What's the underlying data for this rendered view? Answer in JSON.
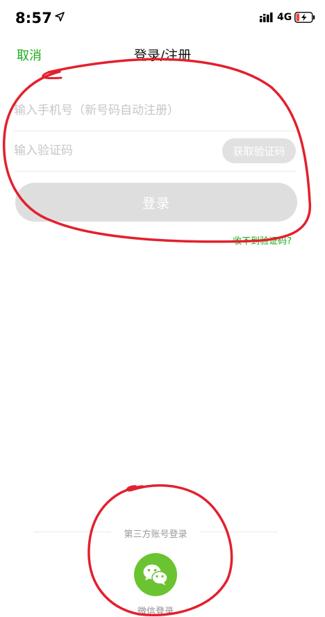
{
  "status_bar": {
    "time": "8:57",
    "network": "4G",
    "icons": [
      "location-arrow-icon",
      "signal-icon",
      "battery-charging-icon"
    ],
    "battery_color": "#f0453a"
  },
  "nav": {
    "cancel_label": "取消",
    "title": "登录/注册"
  },
  "form": {
    "phone_placeholder": "输入手机号（新号码自动注册）",
    "phone_value": "",
    "code_placeholder": "输入验证码",
    "code_value": "",
    "get_code_label": "获取验证码",
    "login_label": "登录",
    "no_code_link": "收不到验证码?"
  },
  "third_party": {
    "label": "第三方账号登录",
    "wechat_label": "微信登录",
    "wechat_icon": "wechat-icon"
  },
  "colors": {
    "accent": "#1aad19",
    "wechat": "#6cc331",
    "disabled_button": "#dedede",
    "annotation": "#e3202e"
  }
}
